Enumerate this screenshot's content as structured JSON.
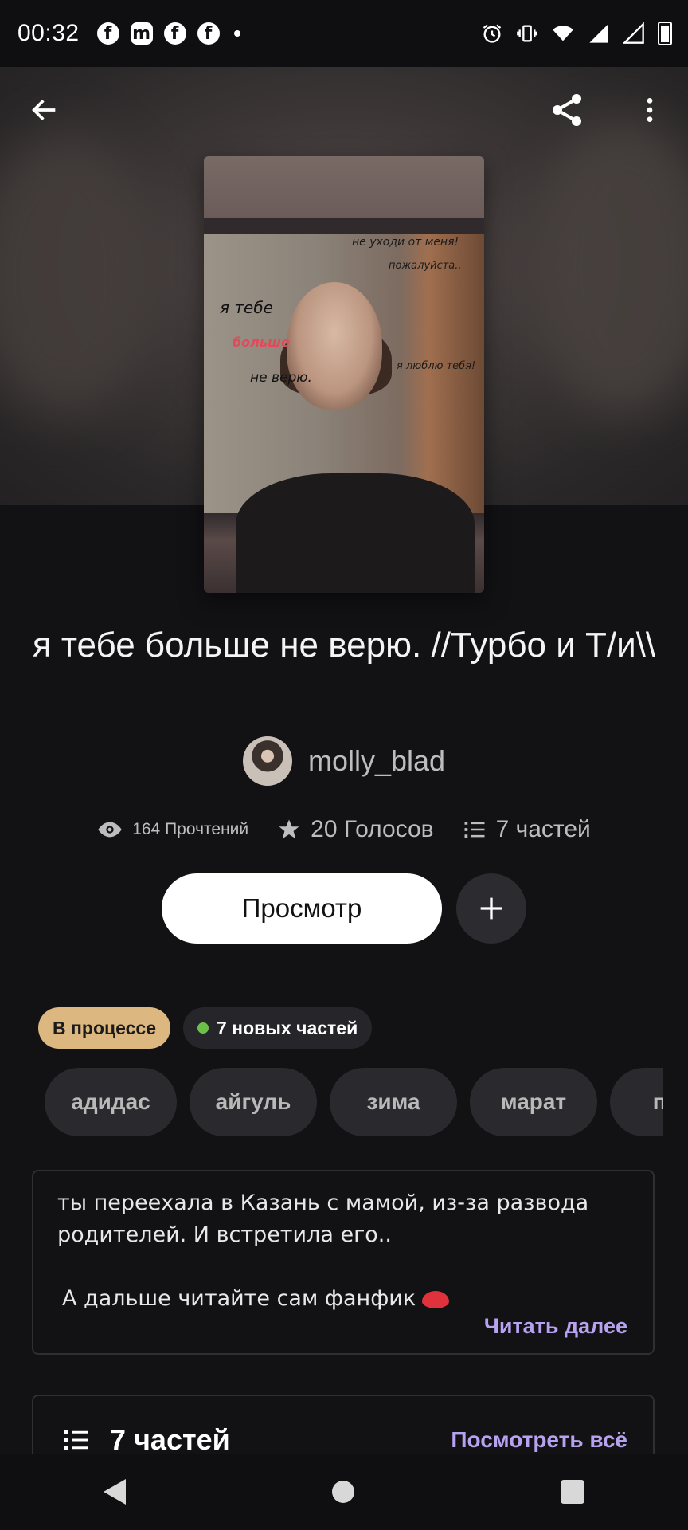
{
  "status_bar": {
    "time": "00:32",
    "notification_icons": [
      "facebook-icon",
      "messenger-icon",
      "facebook-icon",
      "facebook-icon"
    ],
    "right_icons": [
      "alarm-icon",
      "vibrate-icon",
      "wifi-icon",
      "signal-icon",
      "signal-icon",
      "battery-icon"
    ]
  },
  "topbar": {
    "back_icon": "arrow-left-icon",
    "share_icon": "share-icon",
    "more_icon": "more-vertical-icon"
  },
  "cover": {
    "overlay_texts": [
      "не уходи от меня!",
      "пожалуйста..",
      "я тебе",
      "больше",
      "не верю.",
      "я люблю тебя!"
    ]
  },
  "story": {
    "title": "я тебе больше не верю. //Турбо и Т/и\\\\",
    "author": "molly_blad"
  },
  "stats": {
    "reads": "164 Прочтений",
    "votes": "20 Голосов",
    "parts": "7 частей"
  },
  "actions": {
    "view_label": "Просмотр",
    "add_icon": "plus-icon"
  },
  "badges": {
    "status": "В процессе",
    "new_parts": "7 новых частей"
  },
  "tags": [
    "адидас",
    "айгуль",
    "зима",
    "марат",
    "па"
  ],
  "description": {
    "line1": "ты переехала в Казань с мамой, из-за развода родителей. И встретила его..",
    "line2": "А дальше читайте сам фанфик",
    "read_more": "Читать далее"
  },
  "parts_section": {
    "label": "7 частей",
    "see_all": "Посмотреть всё"
  },
  "colors": {
    "background": "#121114",
    "accent_link": "#b6a2f0",
    "status_badge": "#dcb77f",
    "new_dot": "#6cc04a"
  }
}
